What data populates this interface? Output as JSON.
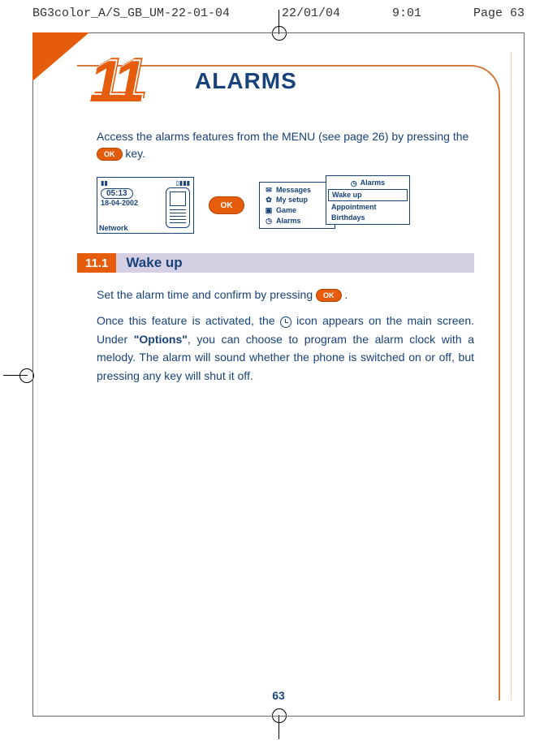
{
  "crop": {
    "filename": "BG3color_A/S_GB_UM-22-01-04",
    "date": "22/01/04",
    "time": "9:01",
    "page_label": "Page 63"
  },
  "chapter": {
    "number": "11",
    "title": "ALARMS"
  },
  "intro": {
    "part1": "Access the alarms features from the MENU (see page 26) by pressing the ",
    "part2": " key."
  },
  "ok_label": "OK",
  "phone": {
    "time": "05:13",
    "date": "18-04-2002",
    "network": "Network"
  },
  "menu": {
    "items": [
      "Messages",
      "My setup",
      "Game",
      "Alarms"
    ]
  },
  "submenu": {
    "title": "Alarms",
    "selected": "Wake up",
    "items": [
      "Appointment",
      "Birthdays"
    ]
  },
  "section": {
    "number": "11.1",
    "title": "Wake up"
  },
  "p1": {
    "text": "Set the alarm time and confirm by pressing ",
    "tail": " ."
  },
  "p2": {
    "a": "Once this feature is activated, the ",
    "b": " icon appears on the main screen. Under ",
    "options": "\"Options\"",
    "c": ", you can choose to program the alarm clock with a melody. The alarm will sound whether the phone is switched on or off, but pressing any key will shut it off."
  },
  "page_number": "63"
}
